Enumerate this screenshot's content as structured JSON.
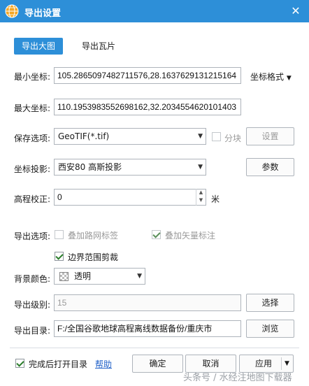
{
  "window": {
    "title": "导出设置",
    "close_glyph": "✕",
    "logo_icon": "globe-icon"
  },
  "tabs": [
    {
      "label": "导出大图",
      "active": true
    },
    {
      "label": "导出瓦片",
      "active": false
    }
  ],
  "min_coord": {
    "label": "最小坐标:",
    "value": "105.2865097482711576,28.1637629131215164",
    "format_label": "坐标格式"
  },
  "max_coord": {
    "label": "最大坐标:",
    "value": "110.1953983552698162,32.2034554620101403"
  },
  "save_option": {
    "label": "保存选项:",
    "value": "GeoTIF(*.tif)",
    "tile_label": "分块",
    "settings_label": "设置"
  },
  "projection": {
    "label": "坐标投影:",
    "value": "西安80 高斯投影",
    "params_label": "参数"
  },
  "elevation": {
    "label": "高程校正:",
    "value": "0",
    "unit": "米"
  },
  "export_options": {
    "label": "导出选项:",
    "road_label": "叠加路网标签",
    "vector_label": "叠加矢量标注",
    "clip_label": "边界范围剪裁"
  },
  "background": {
    "label": "背景颜色:",
    "value": "透明"
  },
  "level": {
    "label": "导出级别:",
    "value": "15",
    "select_label": "选择"
  },
  "directory": {
    "label": "导出目录:",
    "value": "F:/全国谷歌地球高程离线数据备份/重庆市",
    "browse_label": "浏览"
  },
  "footer": {
    "open_after_label": "完成后打开目录",
    "help_label": "帮助",
    "ok_label": "确定",
    "cancel_label": "取消",
    "apply_label": "应用"
  },
  "watermark": "头条号 / 水经注地图下载器",
  "colors": {
    "accent": "#2d8fd8",
    "link": "#2060c8"
  }
}
